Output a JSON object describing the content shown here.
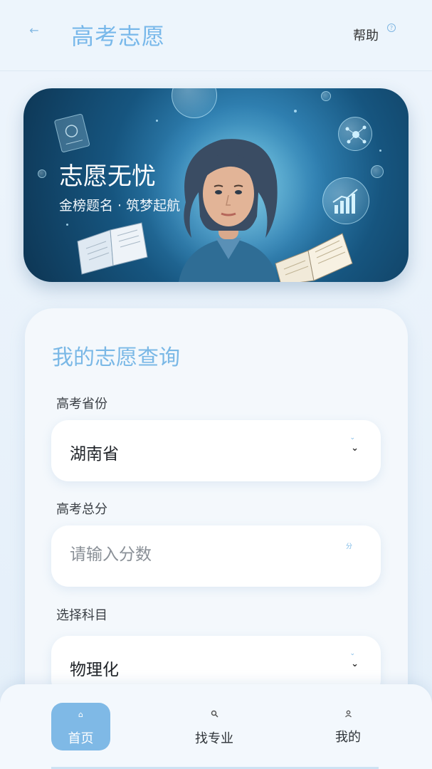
{
  "header": {
    "back_icon": "arrow-left-icon",
    "title": "高考志愿",
    "help_label": "帮助",
    "help_icon": "question-circle-icon",
    "accent_color": "#78b8ea"
  },
  "banner": {
    "title": "志愿无忧",
    "subtitle": "金榜题名 · 筑梦起航"
  },
  "form": {
    "title": "我的志愿查询",
    "province": {
      "label": "高考省份",
      "value": "湖南省",
      "icon": "chevron-down-icon"
    },
    "score": {
      "label": "高考总分",
      "placeholder": "请输入分数",
      "unit": "分"
    },
    "subjects": {
      "label": "选择科目",
      "value": "物理化",
      "icon": "chevron-down-icon"
    }
  },
  "bottom_nav": {
    "items": [
      {
        "label": "首页",
        "icon": "home-icon",
        "active": true
      },
      {
        "label": "找专业",
        "icon": "search-icon",
        "active": false
      },
      {
        "label": "我的",
        "icon": "user-icon",
        "active": false
      }
    ]
  }
}
